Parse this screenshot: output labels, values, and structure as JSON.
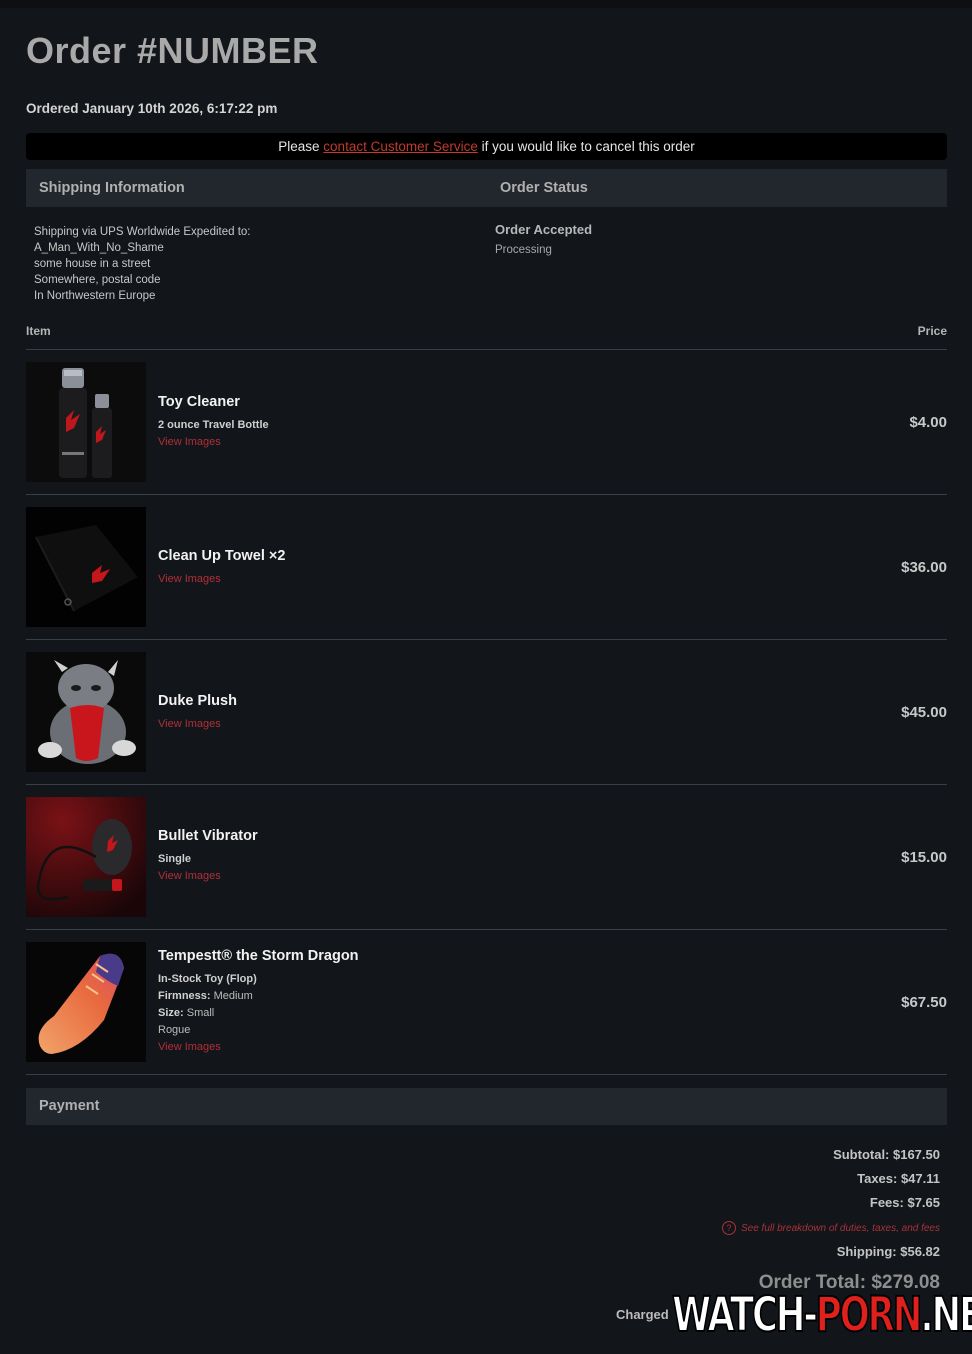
{
  "order": {
    "title": "Order #NUMBER",
    "ordered_date": "Ordered January 10th 2026, 6:17:22 pm"
  },
  "cancel": {
    "prefix": "Please ",
    "link": "contact Customer Service",
    "suffix": " if you would like to cancel this order"
  },
  "shipping": {
    "header": "Shipping Information",
    "lines": [
      "Shipping via UPS Worldwide Expedited to:",
      "A_Man_With_No_Shame",
      "some house in a street",
      "Somewhere, postal code",
      "In Northwestern Europe"
    ]
  },
  "status": {
    "header": "Order Status",
    "title": "Order Accepted",
    "sub": "Processing"
  },
  "table": {
    "item_header": "Item",
    "price_header": "Price"
  },
  "items": [
    {
      "name": "Toy Cleaner",
      "option": "2 ounce Travel Bottle",
      "view": "View Images",
      "price": "$4.00",
      "image": "bottle-icon"
    },
    {
      "name": "Clean Up Towel ×2",
      "view": "View Images",
      "price": "$36.00",
      "image": "towel-icon"
    },
    {
      "name": "Duke Plush",
      "view": "View Images",
      "price": "$45.00",
      "image": "plush-dragon-icon"
    },
    {
      "name": "Bullet Vibrator",
      "option": "Single",
      "view": "View Images",
      "price": "$15.00",
      "image": "vibrator-icon"
    },
    {
      "name": "Tempestt® the Storm Dragon",
      "option": "In-Stock Toy (Flop)",
      "firmness_label": "Firmness:",
      "firmness": " Medium",
      "size_label": "Size:",
      "size": " Small",
      "color": "Rogue",
      "view": "View Images",
      "price": "$67.50",
      "image": "toy-icon"
    }
  ],
  "payment": {
    "header": "Payment",
    "subtotal": "Subtotal: $167.50",
    "taxes": "Taxes: $47.11",
    "fees": "Fees: $7.65",
    "breakdown": "See full breakdown of duties, taxes, and fees",
    "shipping": "Shipping: $56.82",
    "total": "Order Total: $279.08",
    "charged": "Charged"
  },
  "watermark": {
    "left": "WATCH-",
    "mid": "PORN",
    "right": ".NET"
  },
  "colors": {
    "accent": "#c0392b",
    "bg": "#121519",
    "header_bg": "#22272e"
  }
}
